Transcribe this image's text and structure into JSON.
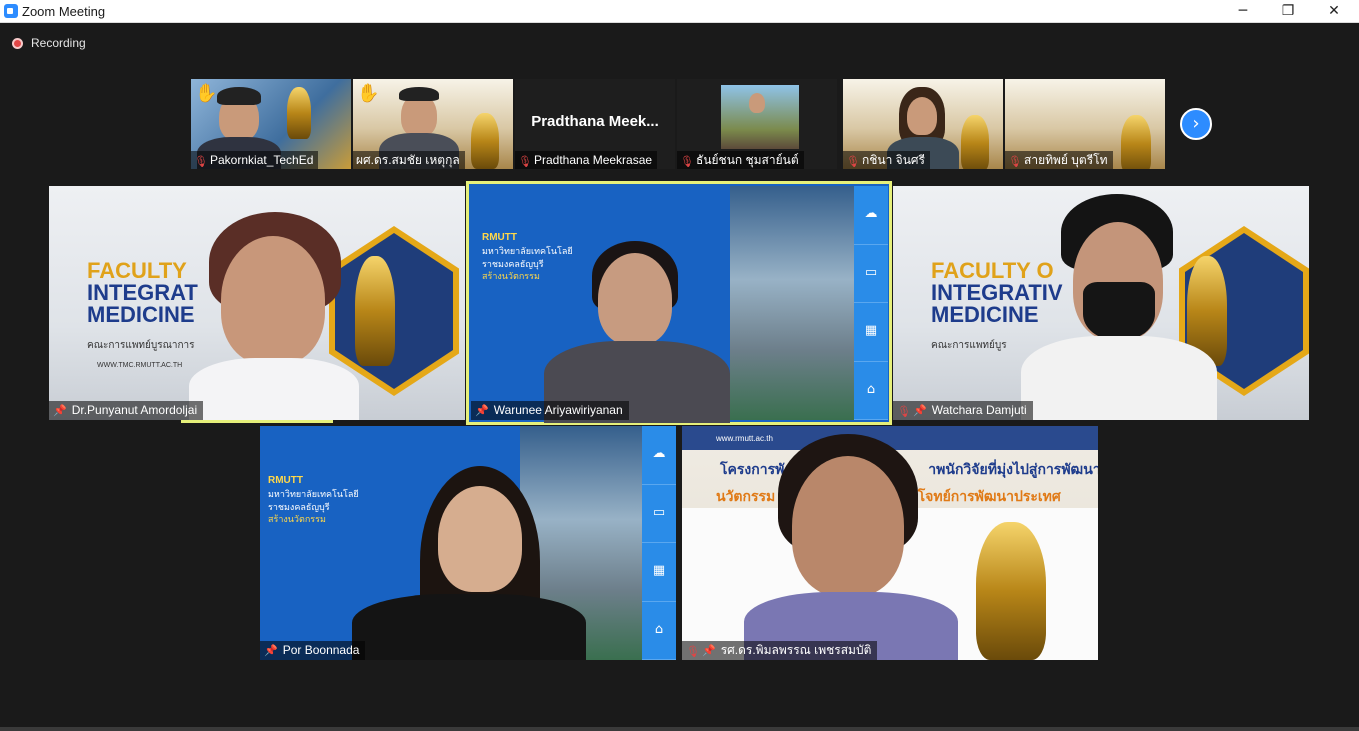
{
  "window": {
    "title": "Zoom Meeting",
    "controls": {
      "minimize": "─",
      "maximize": "❐",
      "close": "✕"
    }
  },
  "recording": {
    "label": "Recording"
  },
  "gallery_strip": [
    {
      "name": "Pakornkiat_TechEd",
      "muted": true,
      "hand_raised": true
    },
    {
      "name": "ผศ.ดร.สมชัย เหตุกุล",
      "muted": false,
      "hand_raised": true
    },
    {
      "name": "Pradthana Meekrasae",
      "muted": true,
      "hand_raised": false,
      "display_label": "Pradthana  Meek..."
    },
    {
      "name": "ธันย์ชนก ชุมสาย์นต์",
      "muted": true,
      "hand_raised": false
    },
    {
      "name": "กชินา  จินศรี",
      "muted": true,
      "hand_raised": false
    },
    {
      "name": "สายทิพย์  บุตรีโท",
      "muted": true,
      "hand_raised": false
    }
  ],
  "strip_next_icon": "chevron-right-icon",
  "main_tiles": [
    {
      "name": "Dr.Punyanut Amordoljai",
      "pinned": true,
      "muted": false,
      "background": "faculty-slide"
    },
    {
      "name": "Warunee Ariyawiriyanan",
      "pinned": true,
      "muted": false,
      "active_speaker": true,
      "background": "rmutt-blue"
    },
    {
      "name": "Watchara Damjuti",
      "pinned": true,
      "muted": true,
      "background": "faculty-slide"
    },
    {
      "name": "Por Boonnada",
      "pinned": true,
      "muted": false,
      "background": "rmutt-blue"
    },
    {
      "name": "รศ.ดร.พิมลพรรณ เพชรสมบัติ",
      "pinned": true,
      "muted": true,
      "background": "project-slide"
    }
  ],
  "slide_text": {
    "faculty_line1": "FACULTY",
    "faculty_line2": "INTEGRAT",
    "faculty_line3": "MEDICINE",
    "faculty_line2_full": "INTEGRATIV",
    "faculty_line1_full": "FACULTY O",
    "faculty_sub": "คณะการแพทย์บูรณาการ",
    "faculty_sub_short": "คณะการแพทย์บูร",
    "faculty_url": "WWW.TMC.RMUTT.AC.TH",
    "rmutt_logo": "RMUTT",
    "rmutt_line1": "มหาวิทยาลัยเทคโนโลยี",
    "rmutt_line2": "ราชมงคลธัญบุรี",
    "rmutt_line3": "สร้างนวัตกรรม",
    "project_line1": "โครงการพัฒนา",
    "project_line1b": "าพนักวิจัยที่มุ่งไปสู่การพัฒนา",
    "project_line2": "นวัตกรรม เศ",
    "project_line2b": "บโจทย์การพัฒนาประเทศ",
    "project_url": "www.rmutt.ac.th"
  },
  "colors": {
    "background": "#1a1a1a",
    "active_speaker_border": "#e6f07a",
    "zoom_blue": "#2d8cff",
    "muted_red": "#e04545"
  }
}
